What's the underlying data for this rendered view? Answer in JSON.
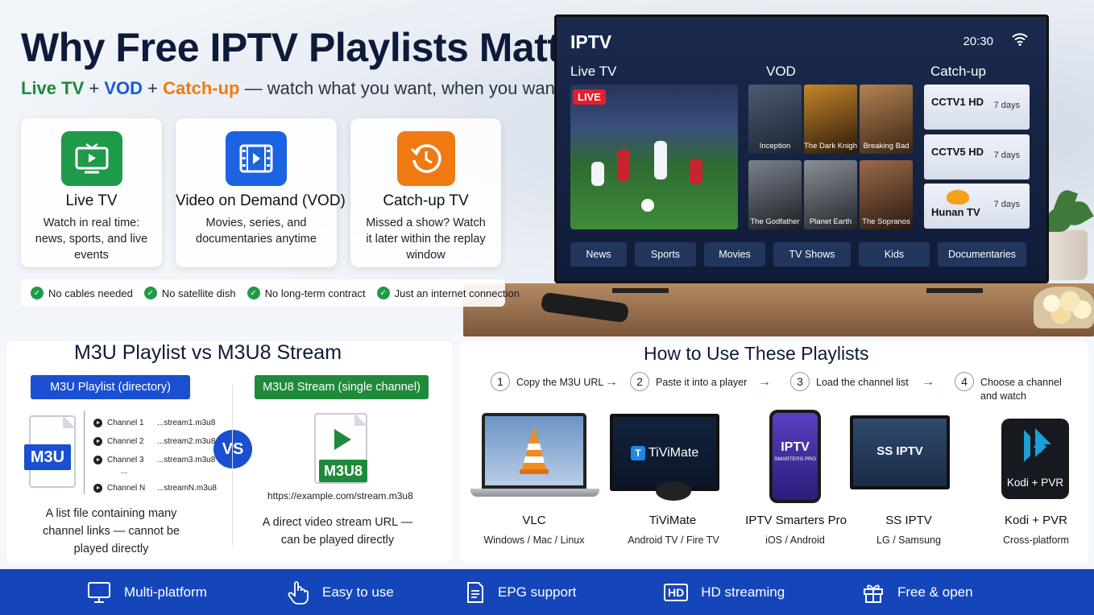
{
  "header": {
    "title": "Why Free IPTV Playlists Matter",
    "subtitle_live": "Live TV",
    "subtitle_plus1": "+",
    "subtitle_vod": "VOD",
    "subtitle_plus2": "+",
    "subtitle_catchup": "Catch-up",
    "subtitle_rest": "— watch what you want, when you want"
  },
  "features": [
    {
      "title": "Live TV",
      "desc": "Watch in real time: news, sports, and live events",
      "icon": "tv-icon",
      "color": "#1f9a48"
    },
    {
      "title": "Video on Demand (VOD)",
      "desc": "Movies, series, and documentaries anytime",
      "icon": "film-icon",
      "color": "#1b63e0"
    },
    {
      "title": "Catch-up TV",
      "desc": "Missed a show? Watch it later within the replay window",
      "icon": "history-icon",
      "color": "#f07a12"
    }
  ],
  "checks": [
    "No cables needed",
    "No satellite dish",
    "No long-term contract",
    "Just an internet connection"
  ],
  "tv": {
    "brand": "IPTV",
    "time": "20:30",
    "sections": {
      "live": "Live TV",
      "vod": "VOD",
      "catchup": "Catch-up"
    },
    "live_badge": "LIVE",
    "vod_titles": [
      "Inception",
      "The Dark Knight",
      "Breaking Bad",
      "The Godfather",
      "Planet Earth",
      "The Sopranos"
    ],
    "catchup": [
      {
        "channel": "CCTV1 HD",
        "days": "7 days"
      },
      {
        "channel": "CCTV5 HD",
        "days": "7 days"
      },
      {
        "channel": "Hunan TV",
        "days": "7 days"
      }
    ],
    "categories": [
      "News",
      "Sports",
      "Movies",
      "TV Shows",
      "Kids",
      "Documentaries"
    ]
  },
  "compare": {
    "title": "M3U Playlist vs M3U8 Stream",
    "m3u_tag": "M3U Playlist (directory)",
    "m3u8_tag": "M3U8 Stream (single channel)",
    "m3u_label": "M3U",
    "m3u8_label": "M3U8",
    "channels": [
      {
        "name": "Channel 1",
        "url": "...stream1.m3u8"
      },
      {
        "name": "Channel 2",
        "url": "...stream2.m3u8"
      },
      {
        "name": "Channel 3",
        "url": "...stream3.m3u8"
      },
      {
        "name": "Channel N",
        "url": "...streamN.m3u8"
      }
    ],
    "ellipsis": "...",
    "vs": "VS",
    "example_url": "https://example.com/stream.m3u8",
    "m3u_desc": "A list file containing many channel links — cannot be played directly",
    "m3u8_desc": "A direct video stream URL — can be played directly"
  },
  "howto": {
    "title": "How to Use These Playlists",
    "steps": [
      {
        "num": "1",
        "text": "Copy the M3U URL"
      },
      {
        "num": "2",
        "text": "Paste it into a player"
      },
      {
        "num": "3",
        "text": "Load the channel list"
      },
      {
        "num": "4",
        "text": "Choose a channel and watch"
      }
    ],
    "arrow": "→",
    "devices": [
      {
        "name": "VLC",
        "platform": "Windows / Mac / Linux"
      },
      {
        "name": "TiViMate",
        "platform": "Android TV / Fire TV",
        "screen_text": "TiViMate"
      },
      {
        "name": "IPTV Smarters Pro",
        "platform": "iOS / Android",
        "screen_text": "IPTV",
        "screen_sub": "SMARTERS PRO"
      },
      {
        "name": "SS IPTV",
        "platform": "LG / Samsung",
        "screen_text": "SS IPTV"
      },
      {
        "name": "Kodi + PVR",
        "platform": "Cross-platform",
        "screen_text": "Kodi + PVR"
      }
    ]
  },
  "footer": [
    {
      "label": "Multi-platform",
      "icon": "monitor-icon"
    },
    {
      "label": "Easy to use",
      "icon": "hand-pointer-icon"
    },
    {
      "label": "EPG support",
      "icon": "document-icon"
    },
    {
      "label": "HD streaming",
      "icon": "hd-icon",
      "badge": "HD"
    },
    {
      "label": "Free & open",
      "icon": "gift-icon"
    }
  ]
}
